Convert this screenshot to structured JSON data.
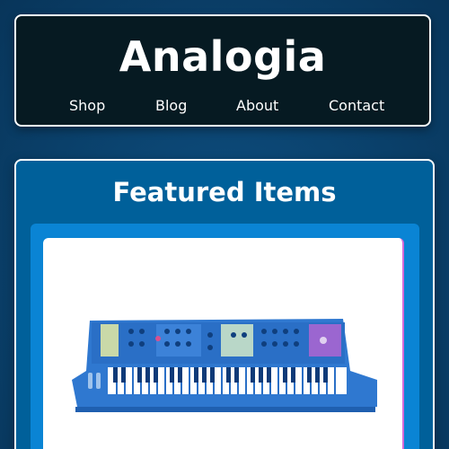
{
  "site": {
    "brand": "Analogia",
    "nav": [
      {
        "label": "Shop"
      },
      {
        "label": "Blog"
      },
      {
        "label": "About"
      },
      {
        "label": "Contact"
      }
    ]
  },
  "featured": {
    "title": "Featured Items",
    "items": [
      {
        "image_icon": "synthesizer-icon"
      }
    ]
  },
  "colors": {
    "header_bg": "#061a22",
    "page_bg": "#0b4470",
    "featured_bg": "#00609a",
    "card_frame": "#0a84d4",
    "card_accent": "#d46ad8"
  }
}
